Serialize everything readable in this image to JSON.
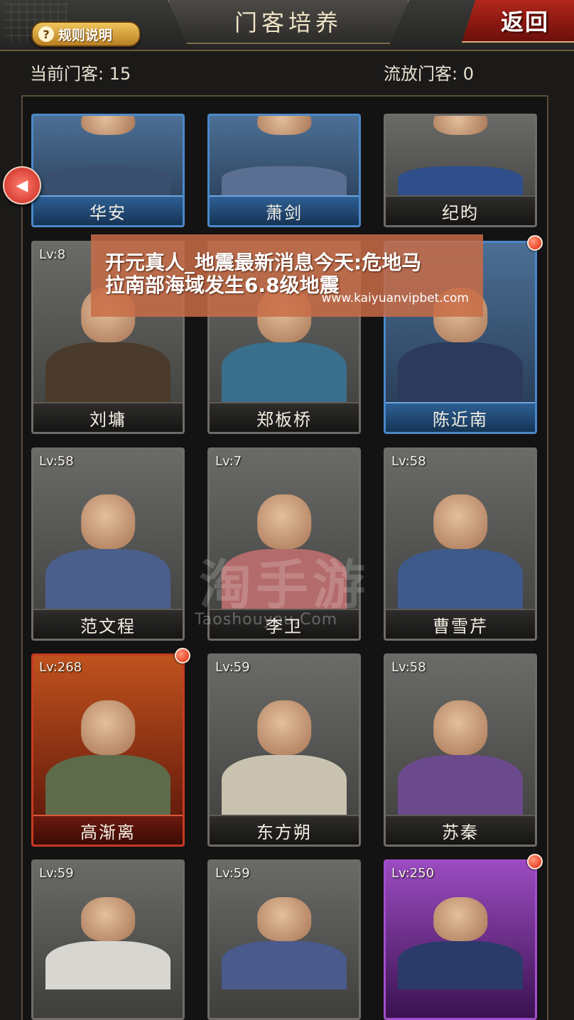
{
  "header": {
    "title": "门客培养",
    "rules_label": "规则说明",
    "rules_icon": "question-icon",
    "back_label": "返回"
  },
  "counts": {
    "current": "当前门客: 15",
    "exiled": "流放门客: 0"
  },
  "colors": {
    "blue_frame": "#4b88c9",
    "red_frame": "#c63a22",
    "purple_frame": "#a14fcc",
    "alert_dot": "#e2220e"
  },
  "cards": [
    {
      "name": "华安",
      "level": "",
      "frame": "blue",
      "dot": false
    },
    {
      "name": "萧剑",
      "level": "",
      "frame": "blue",
      "dot": false
    },
    {
      "name": "纪昀",
      "level": "",
      "frame": "gray",
      "dot": false
    },
    {
      "name": "刘墉",
      "level": "Lv:8",
      "frame": "gray",
      "dot": false
    },
    {
      "name": "郑板桥",
      "level": "",
      "frame": "gray",
      "dot": false
    },
    {
      "name": "陈近南",
      "level": "",
      "frame": "blue",
      "dot": true
    },
    {
      "name": "范文程",
      "level": "Lv:58",
      "frame": "gray",
      "dot": false
    },
    {
      "name": "李卫",
      "level": "Lv:7",
      "frame": "gray",
      "dot": false
    },
    {
      "name": "曹雪芹",
      "level": "Lv:58",
      "frame": "gray",
      "dot": false
    },
    {
      "name": "高渐离",
      "level": "Lv:268",
      "frame": "red",
      "dot": true
    },
    {
      "name": "东方朔",
      "level": "Lv:59",
      "frame": "gray",
      "dot": false
    },
    {
      "name": "苏秦",
      "level": "Lv:58",
      "frame": "gray",
      "dot": false
    },
    {
      "name": "",
      "level": "Lv:59",
      "frame": "gray",
      "dot": false
    },
    {
      "name": "",
      "level": "Lv:59",
      "frame": "gray",
      "dot": false
    },
    {
      "name": "",
      "level": "Lv:250",
      "frame": "purple",
      "dot": true
    }
  ],
  "ad": {
    "line1": "开元真人_地震最新消息今天:危地马",
    "line2": "拉南部海域发生6.8级地震",
    "url": "www.kaiyuanvipbet.com"
  },
  "watermark": {
    "big": "淘手游",
    "small": "Taoshouyou.Com"
  }
}
